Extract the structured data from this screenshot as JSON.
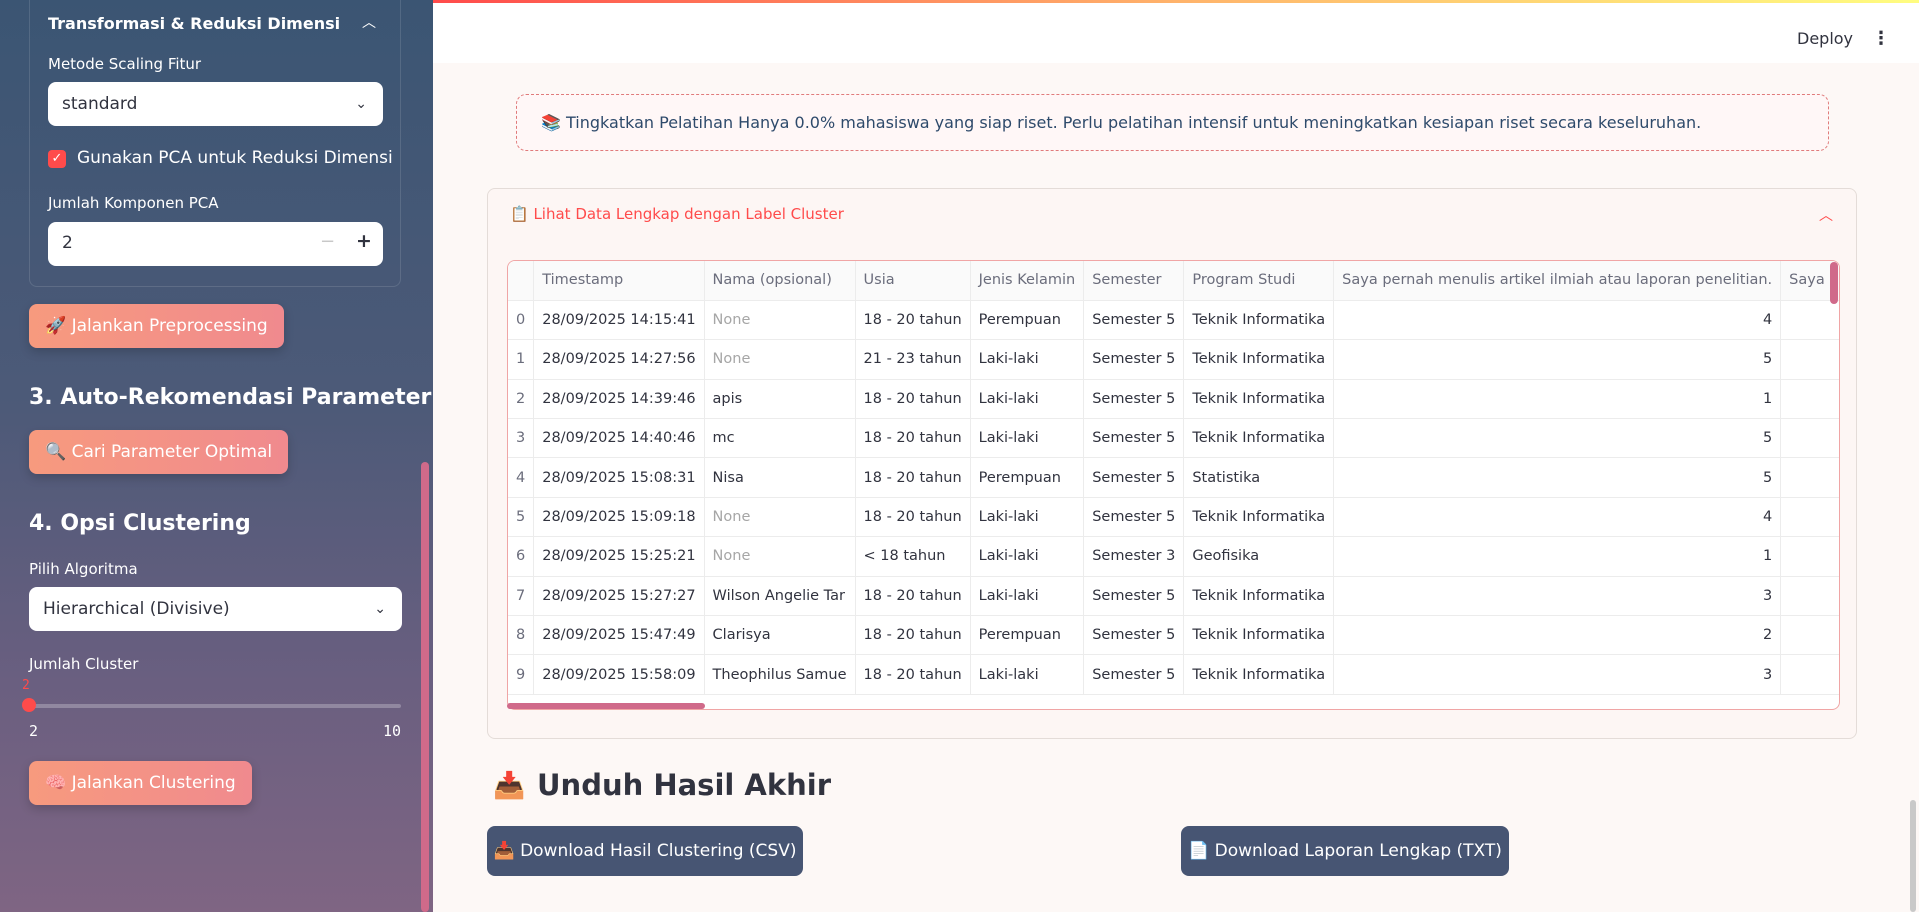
{
  "sidebar": {
    "expander_title": "Transformasi & Reduksi Dimensi",
    "scaling_label": "Metode Scaling Fitur",
    "scaling_value": "standard",
    "pca_checkbox_label": "Gunakan PCA untuk Reduksi Dimensi",
    "pca_checked": true,
    "pca_components_label": "Jumlah Komponen PCA",
    "pca_components_value": "2",
    "preprocess_button": "🚀 Jalankan Preprocessing",
    "section3_title": "3. Auto-Rekomendasi Parameter",
    "optimal_button": "🔍 Cari Parameter Optimal",
    "section4_title": "4. Opsi Clustering",
    "algorithm_label": "Pilih Algoritma",
    "algorithm_value": "Hierarchical (Divisive)",
    "cluster_label": "Jumlah Cluster",
    "cluster_value": "2",
    "cluster_min": "2",
    "cluster_max": "10",
    "cluster_button": "🧠 Jalankan Clustering"
  },
  "header": {
    "deploy_label": "Deploy",
    "menu_icon": "⋮"
  },
  "alert": {
    "text": "📚 Tingkatkan Pelatihan Hanya 0.0% mahasiswa yang siap riset. Perlu pelatihan intensif untuk meningkatkan kesiapan riset secara keseluruhan."
  },
  "data_card": {
    "title": "📋 Lihat Data Lengkap dengan Label Cluster",
    "columns": [
      "",
      "Timestamp",
      "Nama (opsional)",
      "Usia",
      "Jenis Kelamin",
      "Semester",
      "Program Studi",
      "Saya pernah menulis artikel ilmiah atau laporan penelitian.",
      "Saya pernah meng"
    ],
    "rows": [
      [
        "0",
        "28/09/2025 14:15:41",
        "None",
        "18 - 20 tahun",
        "Perempuan",
        "Semester 5",
        "Teknik Informatika",
        "4",
        ""
      ],
      [
        "1",
        "28/09/2025 14:27:56",
        "None",
        "21 - 23 tahun",
        "Laki-laki",
        "Semester 5",
        "Teknik Informatika",
        "5",
        ""
      ],
      [
        "2",
        "28/09/2025 14:39:46",
        "apis",
        "18 - 20 tahun",
        "Laki-laki",
        "Semester 5",
        "Teknik Informatika",
        "1",
        ""
      ],
      [
        "3",
        "28/09/2025 14:40:46",
        "mc",
        "18 - 20 tahun",
        "Laki-laki",
        "Semester 5",
        "Teknik Informatika",
        "5",
        ""
      ],
      [
        "4",
        "28/09/2025 15:08:31",
        "Nisa",
        "18 - 20 tahun",
        "Perempuan",
        "Semester 5",
        "Statistika",
        "5",
        ""
      ],
      [
        "5",
        "28/09/2025 15:09:18",
        "None",
        "18 - 20 tahun",
        "Laki-laki",
        "Semester 5",
        "Teknik Informatika",
        "4",
        ""
      ],
      [
        "6",
        "28/09/2025 15:25:21",
        "None",
        "< 18 tahun",
        "Laki-laki",
        "Semester 3",
        "Geofisika",
        "1",
        ""
      ],
      [
        "7",
        "28/09/2025 15:27:27",
        "Wilson Angelie Tar",
        "18 - 20 tahun",
        "Laki-laki",
        "Semester 5",
        "Teknik Informatika",
        "3",
        ""
      ],
      [
        "8",
        "28/09/2025 15:47:49",
        "Clarisya",
        "18 - 20 tahun",
        "Perempuan",
        "Semester 5",
        "Teknik Informatika",
        "2",
        ""
      ],
      [
        "9",
        "28/09/2025 15:58:09",
        "Theophilus Samue",
        "18 - 20 tahun",
        "Laki-laki",
        "Semester 5",
        "Teknik Informatika",
        "3",
        ""
      ]
    ]
  },
  "download": {
    "icon": "📥",
    "title": "Unduh Hasil Akhir",
    "csv_button": "📥 Download Hasil Clustering (CSV)",
    "txt_button": "📄 Download Laporan Lengkap (TXT)"
  },
  "colors": {
    "accent": "#ff4b4b",
    "sidebar_top": "#3b5573",
    "sidebar_bottom": "#7f6583",
    "button_dark": "#475573"
  }
}
